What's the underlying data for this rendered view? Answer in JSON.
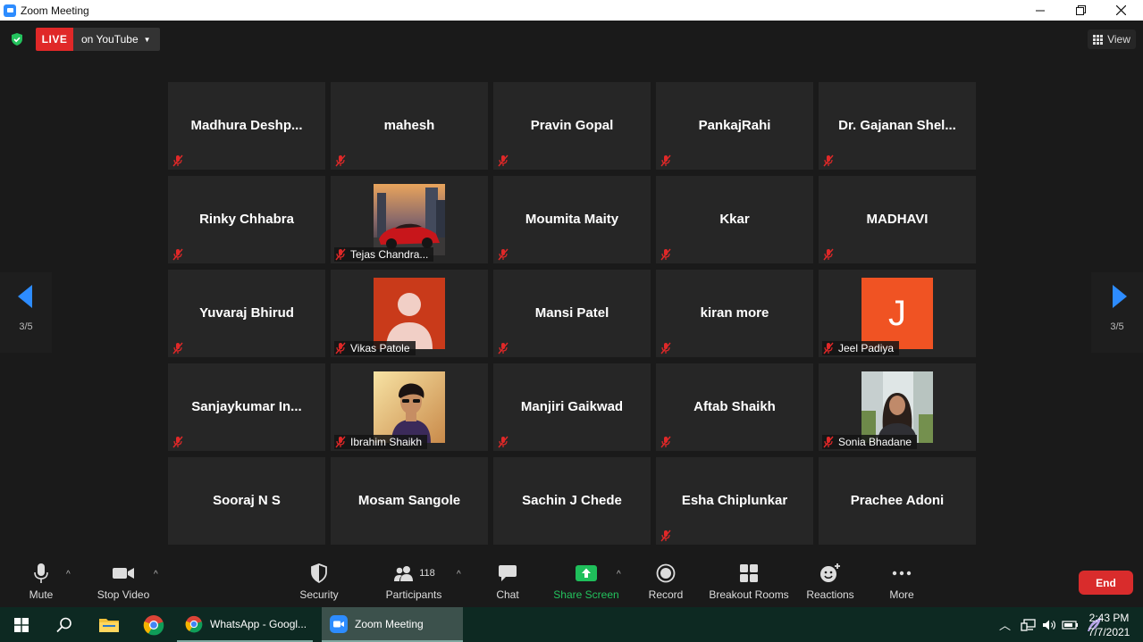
{
  "window": {
    "title": "Zoom Meeting"
  },
  "header": {
    "live_label": "LIVE",
    "stream_target": "on YouTube",
    "view_label": "View"
  },
  "pagination": {
    "left": "3/5",
    "right": "3/5"
  },
  "colors": {
    "accent": "#2d8cff",
    "live": "#e02828",
    "muted": "#e02828",
    "share_green": "#1fbf5b",
    "end": "#d92c2c"
  },
  "participants": [
    {
      "name": "Madhura  Deshp...",
      "type": "name"
    },
    {
      "name": "mahesh",
      "type": "name"
    },
    {
      "name": "Pravin Gopal",
      "type": "name"
    },
    {
      "name": "PankajRahi",
      "type": "name"
    },
    {
      "name": "Dr. Gajanan  Shel...",
      "type": "name"
    },
    {
      "name": "Rinky Chhabra",
      "type": "name"
    },
    {
      "name": "Tejas Chandra...",
      "type": "photo",
      "photo": "car-photo"
    },
    {
      "name": "Moumita Maity",
      "type": "name"
    },
    {
      "name": "Kkar",
      "type": "name"
    },
    {
      "name": "MADHAVI",
      "type": "name"
    },
    {
      "name": "Yuvaraj Bhirud",
      "type": "name"
    },
    {
      "name": "Vikas Patole",
      "type": "photo",
      "photo": "default-avatar"
    },
    {
      "name": "Mansi Patel",
      "type": "name"
    },
    {
      "name": "kiran more",
      "type": "name"
    },
    {
      "name": "Jeel Padiya",
      "type": "photo",
      "photo": "initial-avatar",
      "initial": "J"
    },
    {
      "name": "Sanjaykumar  In...",
      "type": "name"
    },
    {
      "name": "Ibrahim Shaikh",
      "type": "photo",
      "photo": "man-photo"
    },
    {
      "name": "Manjiri Gaikwad",
      "type": "name"
    },
    {
      "name": "Aftab Shaikh",
      "type": "name"
    },
    {
      "name": "Sonia Bhadane",
      "type": "photo",
      "photo": "woman-photo"
    },
    {
      "name": "Sooraj N S",
      "type": "name"
    },
    {
      "name": "Mosam Sangole",
      "type": "name"
    },
    {
      "name": "Sachin J Chede",
      "type": "name"
    },
    {
      "name": "Esha Chiplunkar",
      "type": "name"
    },
    {
      "name": "Prachee Adoni",
      "type": "name"
    }
  ],
  "toolbar": {
    "mute": "Mute",
    "stop_video": "Stop Video",
    "security": "Security",
    "participants": "Participants",
    "participants_count": "118",
    "chat": "Chat",
    "share_screen": "Share Screen",
    "record": "Record",
    "breakout_rooms": "Breakout Rooms",
    "reactions": "Reactions",
    "more": "More",
    "end": "End"
  },
  "taskbar": {
    "apps": [
      {
        "label": "WhatsApp - Googl...",
        "icon": "chrome-icon"
      },
      {
        "label": "Zoom Meeting",
        "icon": "zoom-icon"
      }
    ],
    "time": "2:43 PM",
    "date": "7/7/2021"
  }
}
